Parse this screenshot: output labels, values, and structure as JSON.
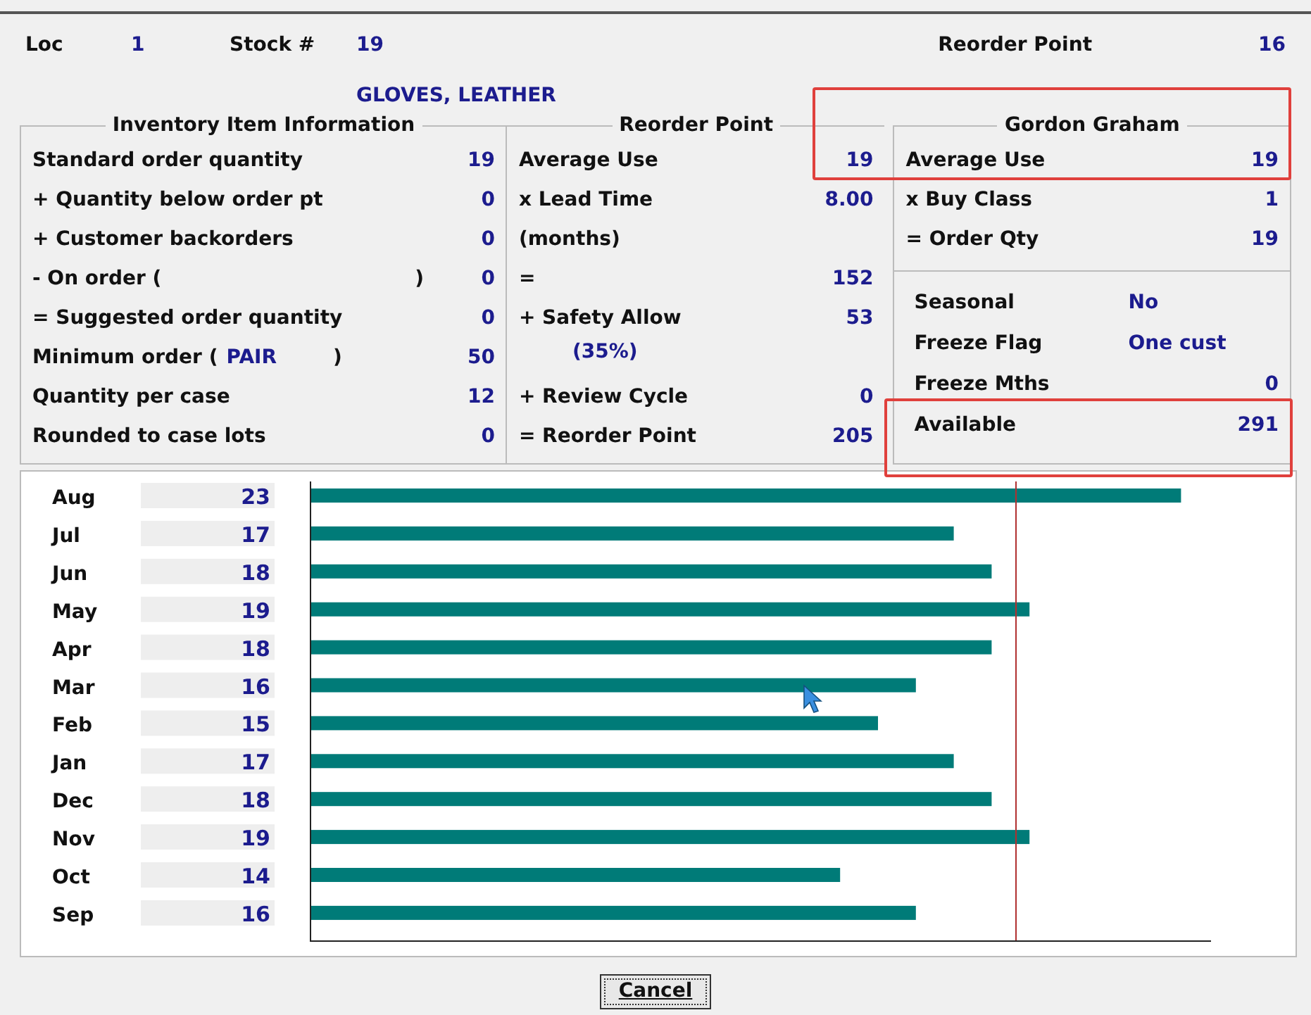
{
  "header": {
    "loc_label": "Loc",
    "loc": "1",
    "stock_label": "Stock #",
    "stock": "19",
    "description": "GLOVES, LEATHER",
    "reorder_label": "Reorder Point",
    "reorder": "16"
  },
  "inventory": {
    "title": "Inventory Item Information",
    "rows": [
      {
        "label": "Standard order quantity",
        "value": "19"
      },
      {
        "label": "+ Quantity below order pt",
        "value": "0"
      },
      {
        "label": "+ Customer backorders",
        "value": "0"
      },
      {
        "label": "- On order (",
        "suffix": ")",
        "value": "0"
      },
      {
        "label": "= Suggested order quantity",
        "value": "0"
      },
      {
        "label": "Minimum order (",
        "unit": "PAIR",
        "suffix": ")",
        "value": "50"
      },
      {
        "label": "Quantity per case",
        "value": "12"
      },
      {
        "label": "Rounded to case lots",
        "value": "0"
      }
    ]
  },
  "reorder_point": {
    "title": "Reorder Point",
    "rows": [
      {
        "kind": "row",
        "label": "Average Use",
        "value": "19"
      },
      {
        "kind": "row",
        "label": "x Lead Time",
        "value": "8.00"
      },
      {
        "kind": "row",
        "label": "(months)"
      },
      {
        "kind": "row",
        "label": "=",
        "value": "152"
      },
      {
        "kind": "row",
        "label": "+ Safety Allow",
        "value": "53"
      },
      {
        "kind": "note",
        "label": "(35%)"
      },
      {
        "kind": "row",
        "label": "+ Review Cycle",
        "value": "0"
      },
      {
        "kind": "row",
        "label": "= Reorder Point",
        "value": "205"
      }
    ]
  },
  "gordon_graham": {
    "title": "Gordon Graham",
    "rows": [
      {
        "label": "Average Use",
        "value": "19"
      },
      {
        "label": "x Buy Class",
        "value": "1"
      },
      {
        "label": "= Order Qty",
        "value": "19"
      }
    ],
    "flags": [
      {
        "kind": "flag",
        "label": "Seasonal",
        "value": "No"
      },
      {
        "kind": "flag",
        "label": "Freeze Flag",
        "value": "One cust"
      },
      {
        "kind": "row",
        "label": "Freeze Mths",
        "value": "0"
      },
      {
        "kind": "row",
        "label": "Available",
        "value": "291"
      }
    ]
  },
  "highlight_boxes": [
    {
      "color": "#e0403c"
    },
    {
      "color": "#e0403c"
    }
  ],
  "usage": {
    "chart_data": {
      "type": "bar",
      "orientation": "horizontal",
      "categories": [
        "Aug",
        "Jul",
        "Jun",
        "May",
        "Apr",
        "Mar",
        "Feb",
        "Jan",
        "Dec",
        "Nov",
        "Oct",
        "Sep"
      ],
      "series": [
        {
          "color": "#007b78",
          "values": [
            23,
            17,
            18,
            19,
            18,
            16,
            15,
            17,
            18,
            19,
            14,
            16
          ]
        }
      ],
      "data_labels": true
    }
  },
  "buttons": [
    "Cancel"
  ]
}
